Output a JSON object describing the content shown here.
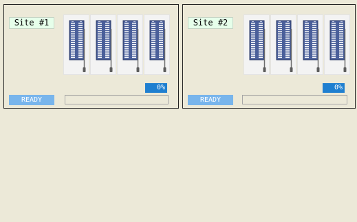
{
  "sites": [
    {
      "label": "Site #1",
      "percent_text": "0%",
      "progress": 0,
      "status": "READY",
      "socket_count": 4
    },
    {
      "label": "Site #2",
      "percent_text": "0%",
      "progress": 0,
      "status": "READY",
      "socket_count": 4
    }
  ],
  "colors": {
    "background": "#ece9d8",
    "site_label_bg": "#e6ffea",
    "status_bg": "#78b5ec",
    "percent_bg": "#1f7fd0",
    "socket_body": "#4a5f9a"
  },
  "icons": {
    "socket": "zif-socket-icon"
  }
}
